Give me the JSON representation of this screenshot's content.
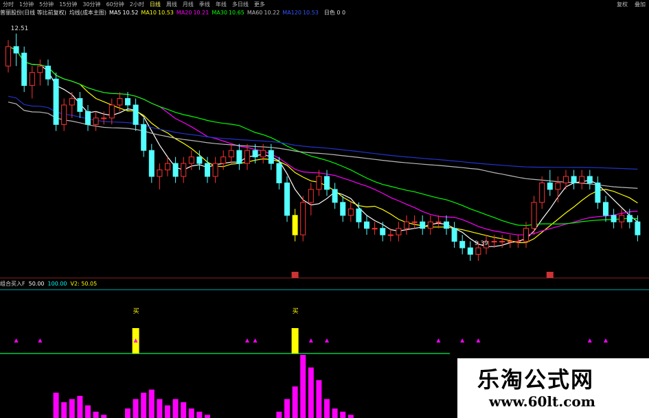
{
  "toolbar": {
    "items": [
      {
        "label": "分时"
      },
      {
        "label": "1分钟"
      },
      {
        "label": "5分钟"
      },
      {
        "label": "15分钟"
      },
      {
        "label": "30分钟"
      },
      {
        "label": "60分钟"
      },
      {
        "label": "2小时"
      },
      {
        "label": "日线",
        "active": true
      },
      {
        "label": "周线"
      },
      {
        "label": "月线"
      },
      {
        "label": "季线"
      },
      {
        "label": "年线"
      },
      {
        "label": "多日线"
      },
      {
        "label": "更多"
      }
    ],
    "right_items": [
      {
        "label": "复权"
      },
      {
        "label": "叠加"
      }
    ]
  },
  "info": {
    "stock": "普丽股份(日线 等比前复权)",
    "indicator": "均线(成本主图)",
    "ma": [
      {
        "label": "MA5",
        "value": "10.52",
        "color": "#ffffff"
      },
      {
        "label": "MA10",
        "value": "10.53",
        "color": "#ffff00"
      },
      {
        "label": "MA20",
        "value": "10.21",
        "color": "#ff00ff"
      },
      {
        "label": "MA30",
        "value": "10.65",
        "color": "#00ff00"
      },
      {
        "label": "MA60",
        "value": "10.22",
        "color": "#bbbbbb"
      },
      {
        "label": "MA120",
        "value": "10.53",
        "color": "#3355ff"
      }
    ],
    "extra": "日色 0 0"
  },
  "lower_info": {
    "name": "组合买入F",
    "v1": "50.00",
    "v2": "100.00",
    "v3": "V2: 50.05"
  },
  "annotations": {
    "high_label": "12.51",
    "low_label": "9.39",
    "buy_marker": "买"
  },
  "watermark": {
    "title": "乐淘公式网",
    "url": "www.60lt.com"
  },
  "colors": {
    "up": "#ff3232",
    "down": "#54ffff",
    "ma5": "#ffffff",
    "ma10": "#ffff00",
    "ma20": "#ff00ff",
    "ma30": "#00ff00",
    "ma60": "#bbbbbb",
    "ma120": "#2233cc",
    "signal": "#ffff00",
    "volume": "#ff00ff",
    "triangle": "#ff00ff"
  },
  "chart_data": [
    {
      "type": "candlestick",
      "series": [
        {
          "name": "MA5",
          "color": "#ffffff"
        },
        {
          "name": "MA10",
          "color": "#ffff00"
        },
        {
          "name": "MA20",
          "color": "#ff00ff"
        },
        {
          "name": "MA30",
          "color": "#00ff00"
        },
        {
          "name": "MA60",
          "color": "#bbbbbb"
        },
        {
          "name": "MA120",
          "color": "#2233cc"
        }
      ],
      "candles": [
        [
          12.0,
          12.4,
          11.9,
          12.3
        ],
        [
          12.3,
          12.5,
          12.0,
          12.2
        ],
        [
          12.2,
          12.3,
          11.6,
          11.7
        ],
        [
          11.7,
          12.0,
          11.5,
          11.9
        ],
        [
          11.9,
          12.1,
          11.7,
          12.0
        ],
        [
          12.0,
          12.1,
          11.7,
          11.8
        ],
        [
          11.8,
          11.9,
          11.0,
          11.1
        ],
        [
          11.1,
          11.5,
          11.0,
          11.4
        ],
        [
          11.4,
          11.6,
          11.2,
          11.5
        ],
        [
          11.5,
          11.6,
          11.2,
          11.3
        ],
        [
          11.3,
          11.4,
          11.0,
          11.1
        ],
        [
          11.1,
          11.3,
          11.0,
          11.2
        ],
        [
          11.2,
          11.3,
          11.1,
          11.2
        ],
        [
          11.2,
          11.5,
          11.1,
          11.4
        ],
        [
          11.4,
          11.6,
          11.3,
          11.5
        ],
        [
          11.5,
          11.6,
          11.3,
          11.4
        ],
        [
          11.4,
          11.5,
          11.0,
          11.1
        ],
        [
          11.1,
          11.2,
          10.6,
          10.7
        ],
        [
          10.7,
          10.8,
          10.2,
          10.3
        ],
        [
          10.3,
          10.5,
          10.1,
          10.4
        ],
        [
          10.4,
          10.6,
          10.3,
          10.5
        ],
        [
          10.5,
          10.6,
          10.2,
          10.3
        ],
        [
          10.3,
          10.6,
          10.2,
          10.5
        ],
        [
          10.5,
          10.7,
          10.4,
          10.6
        ],
        [
          10.6,
          10.7,
          10.4,
          10.5
        ],
        [
          10.5,
          10.6,
          10.2,
          10.3
        ],
        [
          10.3,
          10.6,
          10.2,
          10.5
        ],
        [
          10.5,
          10.7,
          10.4,
          10.6
        ],
        [
          10.6,
          10.8,
          10.5,
          10.7
        ],
        [
          10.7,
          10.8,
          10.4,
          10.5
        ],
        [
          10.5,
          10.8,
          10.4,
          10.7
        ],
        [
          10.7,
          10.8,
          10.5,
          10.6
        ],
        [
          10.6,
          10.8,
          10.5,
          10.7
        ],
        [
          10.7,
          10.8,
          10.4,
          10.5
        ],
        [
          10.5,
          10.6,
          10.1,
          10.2
        ],
        [
          10.2,
          10.3,
          9.6,
          9.7
        ],
        [
          9.7,
          9.8,
          9.3,
          9.4
        ],
        [
          9.4,
          10.0,
          9.3,
          9.9
        ],
        [
          9.9,
          10.2,
          9.7,
          10.1
        ],
        [
          10.1,
          10.4,
          10.0,
          10.3
        ],
        [
          10.3,
          10.4,
          10.0,
          10.1
        ],
        [
          10.1,
          10.2,
          9.8,
          9.9
        ],
        [
          9.9,
          10.0,
          9.6,
          9.7
        ],
        [
          9.7,
          9.9,
          9.6,
          9.8
        ],
        [
          9.8,
          9.9,
          9.5,
          9.6
        ],
        [
          9.6,
          9.7,
          9.4,
          9.5
        ],
        [
          9.5,
          9.6,
          9.4,
          9.5
        ],
        [
          9.5,
          9.6,
          9.3,
          9.4
        ],
        [
          9.4,
          9.5,
          9.3,
          9.4
        ],
        [
          9.4,
          9.6,
          9.3,
          9.5
        ],
        [
          9.5,
          9.7,
          9.4,
          9.6
        ],
        [
          9.6,
          9.7,
          9.5,
          9.6
        ],
        [
          9.6,
          9.7,
          9.4,
          9.5
        ],
        [
          9.5,
          9.7,
          9.4,
          9.6
        ],
        [
          9.6,
          9.7,
          9.5,
          9.6
        ],
        [
          9.6,
          9.7,
          9.4,
          9.5
        ],
        [
          9.5,
          9.6,
          9.2,
          9.3
        ],
        [
          9.3,
          9.4,
          9.1,
          9.2
        ],
        [
          9.2,
          9.3,
          9.0,
          9.1
        ],
        [
          9.1,
          9.3,
          9.0,
          9.2
        ],
        [
          9.2,
          9.4,
          9.1,
          9.3
        ],
        [
          9.3,
          9.4,
          9.2,
          9.3
        ],
        [
          9.3,
          9.4,
          9.2,
          9.3
        ],
        [
          9.3,
          9.4,
          9.2,
          9.3
        ],
        [
          9.3,
          9.4,
          9.2,
          9.3
        ],
        [
          9.3,
          9.6,
          9.2,
          9.5
        ],
        [
          9.5,
          10.0,
          9.4,
          9.9
        ],
        [
          9.9,
          10.3,
          9.8,
          10.2
        ],
        [
          10.2,
          10.4,
          10.0,
          10.1
        ],
        [
          10.1,
          10.3,
          9.9,
          10.2
        ],
        [
          10.2,
          10.4,
          10.1,
          10.3
        ],
        [
          10.3,
          10.4,
          10.1,
          10.2
        ],
        [
          10.2,
          10.4,
          10.1,
          10.3
        ],
        [
          10.3,
          10.4,
          10.1,
          10.2
        ],
        [
          10.2,
          10.3,
          9.8,
          9.9
        ],
        [
          9.9,
          10.0,
          9.6,
          9.7
        ],
        [
          9.7,
          9.8,
          9.5,
          9.6
        ],
        [
          9.6,
          9.8,
          9.5,
          9.7
        ],
        [
          9.7,
          9.8,
          9.5,
          9.6
        ],
        [
          9.6,
          9.7,
          9.3,
          9.4
        ]
      ],
      "signal_bars": [
        36
      ],
      "high_index": 1,
      "high_value": 12.51,
      "low_index": 58,
      "low_value": 9.39,
      "ylim": [
        9.0,
        12.7
      ]
    },
    {
      "type": "bar",
      "name": "组合买入F",
      "signals": [
        16,
        36
      ],
      "triangles": [
        1,
        4,
        16,
        30,
        31,
        38,
        40,
        54,
        57,
        59,
        73,
        75
      ],
      "volume_zone_end": 65,
      "volume": [
        0,
        0,
        0,
        0,
        0,
        0,
        0.8,
        0.5,
        0.6,
        0.7,
        0.4,
        0.2,
        0.1,
        0,
        0,
        0.3,
        0.6,
        0.8,
        0.9,
        0.6,
        0.4,
        0.6,
        0.5,
        0.3,
        0.2,
        0.1,
        0,
        0,
        0,
        0,
        0,
        0,
        0,
        0,
        0.2,
        0.6,
        1.0,
        2.0,
        1.6,
        1.2,
        0.6,
        0.3,
        0.2,
        0.1,
        0,
        0,
        0,
        0,
        0,
        0,
        0,
        0,
        0,
        0,
        0,
        0,
        0,
        0,
        0,
        0,
        0,
        0,
        0,
        0,
        0.6,
        0,
        0,
        0,
        0,
        0,
        0,
        0,
        0,
        0,
        0,
        0,
        0,
        0,
        0,
        0
      ]
    }
  ]
}
